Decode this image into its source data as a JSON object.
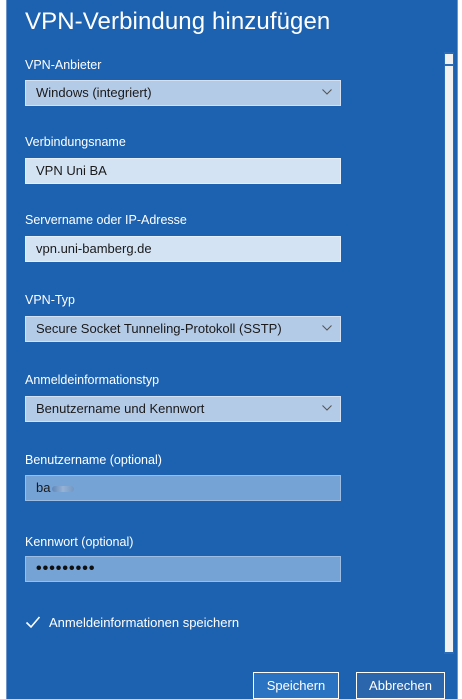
{
  "dialog": {
    "title": "VPN-Verbindung hinzufügen",
    "provider": {
      "label": "VPN-Anbieter",
      "value": "Windows (integriert)"
    },
    "connection_name": {
      "label": "Verbindungsname",
      "value": "VPN Uni BA"
    },
    "server": {
      "label": "Servername oder IP-Adresse",
      "value": "vpn.uni-bamberg.de"
    },
    "vpn_type": {
      "label": "VPN-Typ",
      "value": "Secure Socket Tunneling-Protokoll (SSTP)"
    },
    "credential_type": {
      "label": "Anmeldeinformationstyp",
      "value": "Benutzername und Kennwort"
    },
    "username": {
      "label": "Benutzername (optional)",
      "value": "ba"
    },
    "password": {
      "label": "Kennwort (optional)",
      "value": "•••••••••"
    },
    "remember": {
      "label": "Anmeldeinformationen speichern",
      "checked": true
    },
    "buttons": {
      "save": "Speichern",
      "cancel": "Abbrechen"
    }
  },
  "colors": {
    "background": "#1d62b0",
    "accent": "#ffffff"
  },
  "icons": [
    "chevron-down-icon",
    "checkmark-icon"
  ]
}
